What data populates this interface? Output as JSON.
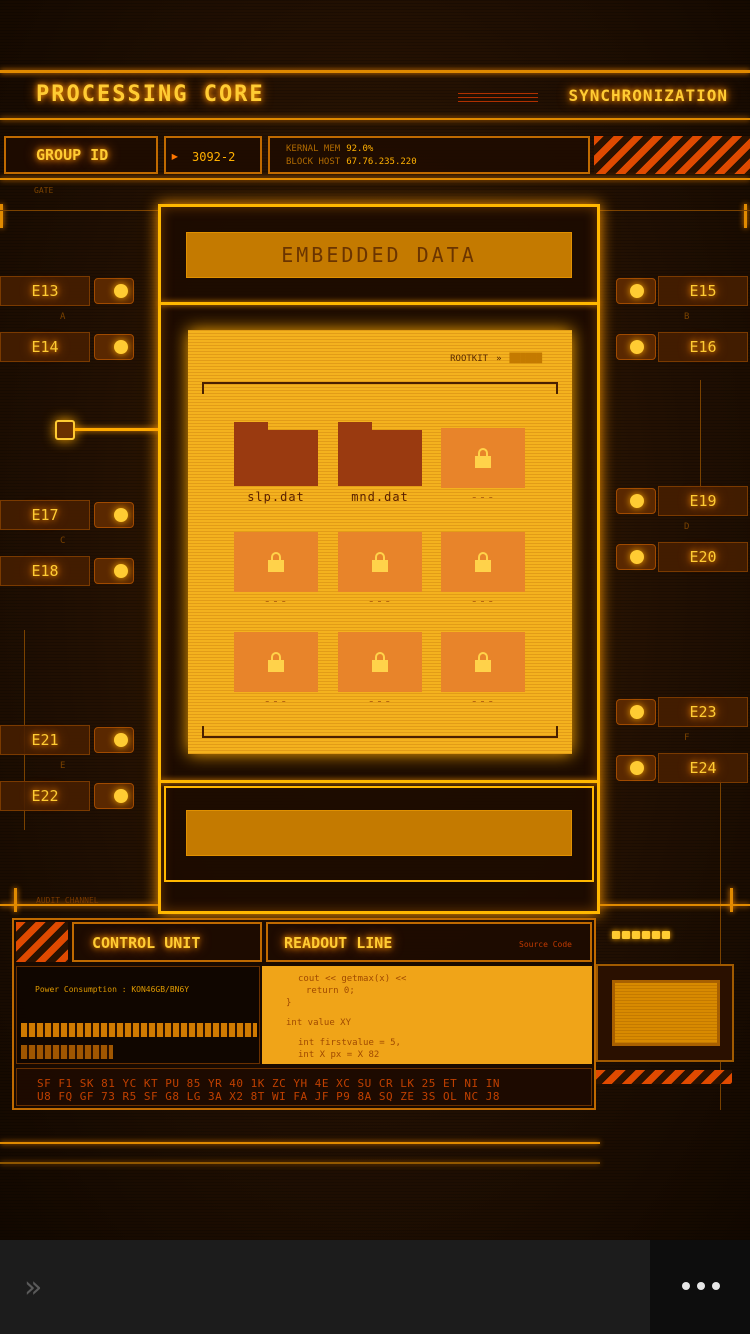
{
  "header": {
    "title": "PROCESSING CORE",
    "status": "SYNCHRONIZATION"
  },
  "group": {
    "label": "GROUP ID",
    "value": "3092-2",
    "kernel_mem_label": "KERNAL MEM",
    "kernel_mem_value": "92.0%",
    "block_host_label": "BLOCK HOST",
    "block_host_value": "67.76.235.220"
  },
  "gate_label": "GATE",
  "left_chips": [
    "E13",
    "E14",
    "E17",
    "E18",
    "E21",
    "E22"
  ],
  "right_chips": [
    "E15",
    "E16",
    "E19",
    "E20",
    "E23",
    "E24"
  ],
  "sub_letters": [
    "A",
    "B",
    "C",
    "D",
    "E",
    "F"
  ],
  "panel": {
    "banner": "EMBEDDED DATA",
    "rootkit_label": "ROOTKIT",
    "rootkit_arrow": "»"
  },
  "files": [
    {
      "name": "slp.dat",
      "locked": false
    },
    {
      "name": "mnd.dat",
      "locked": false
    },
    {
      "name": "---",
      "locked": true
    },
    {
      "name": "---",
      "locked": true
    },
    {
      "name": "---",
      "locked": true
    },
    {
      "name": "---",
      "locked": true
    },
    {
      "name": "---",
      "locked": true
    },
    {
      "name": "---",
      "locked": true
    },
    {
      "name": "---",
      "locked": true
    }
  ],
  "audit_label": "AUDIT CHANNEL",
  "control": {
    "title": "CONTROL UNIT",
    "power_label": "Power Consumption : KON46GB/BN6Y"
  },
  "readout": {
    "title": "READOUT LINE",
    "source": "Source Code",
    "code_lines": [
      "cout << getmax(x) <<",
      "return 0;",
      "}",
      "int value XY",
      "int firstvalue = 5,",
      "int X px = X 82"
    ]
  },
  "hex_rows": [
    "SF F1 SK 81 YC KT PU 85 YR 40 1K ZC YH 4E XC SU CR LK 25 ET NI IN",
    "U8 FQ GF 73 R5 SF G8 LG 3A X2 8T WI FA JF P9 8A SQ ZE 3S OL NC J8"
  ],
  "nav": {
    "forward_glyph": "»"
  },
  "colors": {
    "accent": "#ffb000",
    "glow": "#ff9900",
    "hazard": "#e04a00",
    "screen": "#f4b21e"
  }
}
